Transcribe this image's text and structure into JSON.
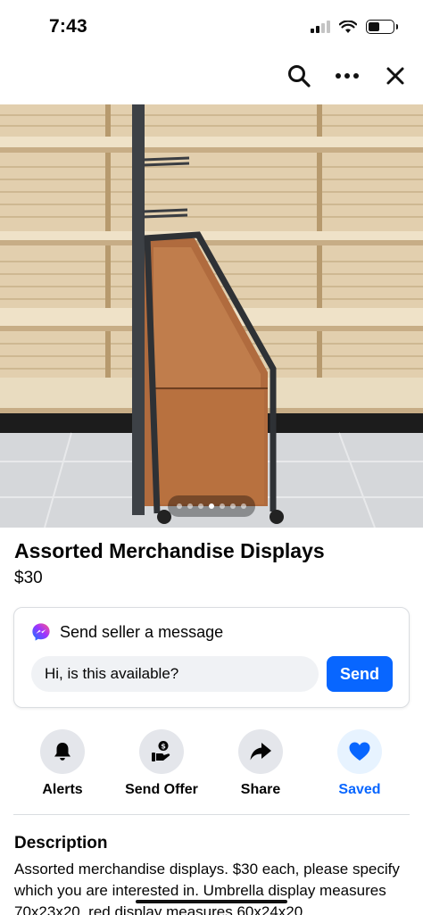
{
  "status_bar": {
    "time": "7:43"
  },
  "top_bar": {
    "icons": [
      "search-icon",
      "more-icon",
      "close-icon"
    ]
  },
  "listing": {
    "photo": {
      "page_count": 7,
      "active_page": 3
    },
    "title": "Assorted Merchandise Displays",
    "price": "$30"
  },
  "message": {
    "header": "Send seller a message",
    "input_value": "Hi, is this available?",
    "send_label": "Send"
  },
  "actions": [
    {
      "label": "Alerts",
      "icon": "bell-icon"
    },
    {
      "label": "Send Offer",
      "icon": "offer-icon"
    },
    {
      "label": "Share",
      "icon": "share-icon"
    },
    {
      "label": "Saved",
      "icon": "heart-icon",
      "active": true
    }
  ],
  "description": {
    "heading": "Description",
    "body": "Assorted merchandise displays. $30 each, please specify which you are interested in. Umbrella display measures 70x23x20, red display measures 60x24x20"
  },
  "colors": {
    "accent": "#0866ff",
    "saved_bg": "#e7f3ff",
    "icon_bg": "#e4e6eb",
    "input_bg": "#f0f2f5"
  }
}
